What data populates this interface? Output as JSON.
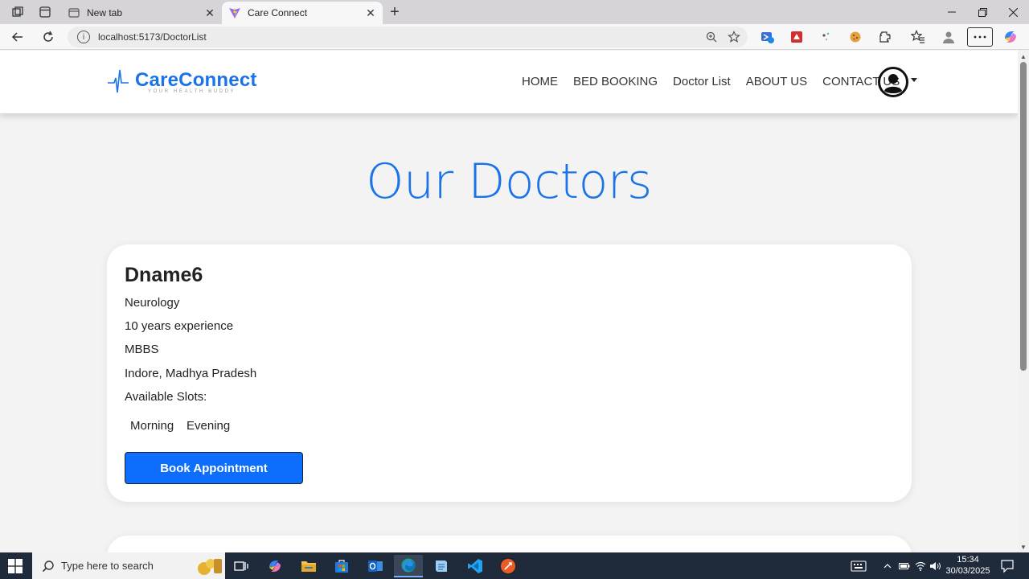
{
  "browser": {
    "tabs": [
      {
        "label": "New tab",
        "icon": "new-tab-page-icon"
      },
      {
        "label": "Care Connect",
        "icon": "vite-icon"
      }
    ],
    "url": "localhost:5173/DoctorList",
    "icons": [
      "workspaces-icon",
      "tab-actions-icon",
      "back-icon",
      "refresh-icon",
      "site-info-icon",
      "zoom-icon",
      "favorite-star-icon",
      "extension-icons",
      "favorites-icon",
      "profile-icon",
      "more-menu-icon",
      "copilot-icon"
    ]
  },
  "site": {
    "brand": "CareConnect",
    "tagline": "YOUR HEALTH BUDDY",
    "nav": [
      "HOME",
      "BED BOOKING",
      "Doctor List",
      "ABOUT US",
      "CONTACT US"
    ],
    "page_title": "Our Doctors"
  },
  "doctor": {
    "name": "Dname6",
    "specialty": "Neurology",
    "experience": "10 years experience",
    "degree": "MBBS",
    "location": "Indore, Madhya Pradesh",
    "slots_label": "Available Slots:",
    "slots": [
      "Morning",
      "Evening"
    ],
    "book_label": "Book Appointment"
  },
  "taskbar": {
    "search_placeholder": "Type here to search",
    "time": "15:34",
    "date": "30/03/2025"
  },
  "colors": {
    "accent": "#1a73e8",
    "button": "#0d6efd",
    "taskbar": "#1f2a3a"
  }
}
